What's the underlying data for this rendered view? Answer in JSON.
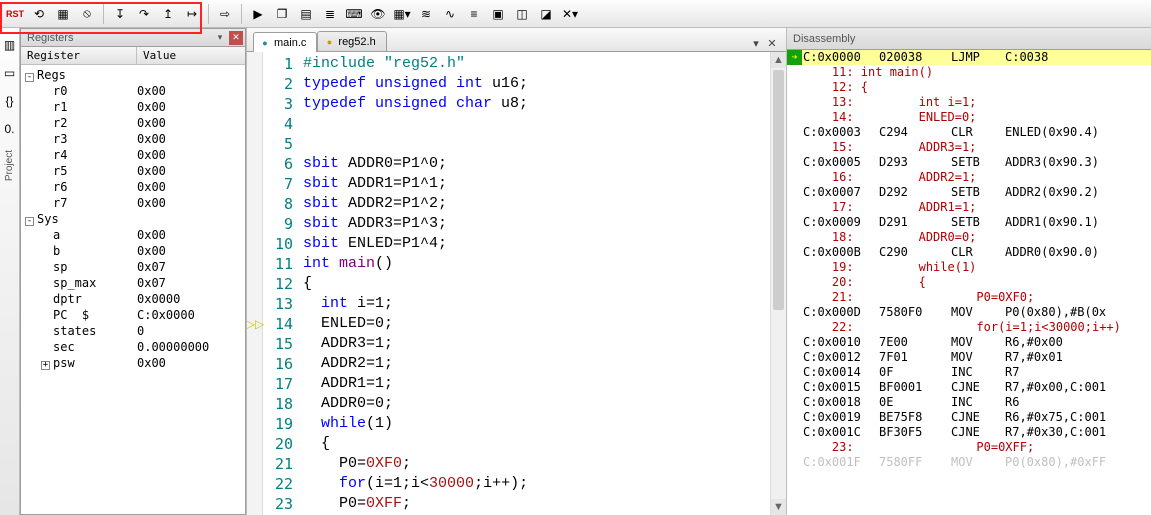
{
  "toolbar": {
    "groups": [
      [
        "reset-icon",
        "step-icon",
        "stop-icon"
      ],
      [
        "step-into-icon",
        "step-over-icon",
        "step-out-icon",
        "run-to-icon"
      ],
      [
        "arrow-right-icon"
      ],
      [
        "run-icon",
        "window-icon",
        "memory-icon",
        "list-icon",
        "output-icon",
        "watch-icon",
        "table-dd-icon",
        "serial-icon",
        "analyzer-icon",
        "trace-icon",
        "coverage-icon",
        "perf-icon",
        "perf2-icon",
        "tools-dd-icon"
      ]
    ],
    "glyphs": {
      "reset-icon": "⟲",
      "step-icon": "▦",
      "stop-icon": "⦸",
      "step-into-icon": "↧",
      "step-over-icon": "↷",
      "step-out-icon": "↥",
      "run-to-icon": "↦",
      "arrow-right-icon": "⇨",
      "run-icon": "▶",
      "window-icon": "❐",
      "memory-icon": "▤",
      "list-icon": "≣",
      "output-icon": "⌨",
      "watch-icon": "👁",
      "table-dd-icon": "▦▾",
      "serial-icon": "≋",
      "analyzer-icon": "∿",
      "trace-icon": "≡",
      "coverage-icon": "▣",
      "perf-icon": "◫",
      "perf2-icon": "◪",
      "tools-dd-icon": "✕▾"
    },
    "rst_label": "RST"
  },
  "sidebar": {
    "label": "Project"
  },
  "registers": {
    "title": "Registers",
    "columns": [
      "Register",
      "Value"
    ],
    "groups": [
      {
        "name": "Regs",
        "expanded": true,
        "items": [
          {
            "k": "r0",
            "v": "0x00"
          },
          {
            "k": "r1",
            "v": "0x00"
          },
          {
            "k": "r2",
            "v": "0x00"
          },
          {
            "k": "r3",
            "v": "0x00"
          },
          {
            "k": "r4",
            "v": "0x00"
          },
          {
            "k": "r5",
            "v": "0x00"
          },
          {
            "k": "r6",
            "v": "0x00"
          },
          {
            "k": "r7",
            "v": "0x00"
          }
        ]
      },
      {
        "name": "Sys",
        "expanded": true,
        "items": [
          {
            "k": "a",
            "v": "0x00"
          },
          {
            "k": "b",
            "v": "0x00"
          },
          {
            "k": "sp",
            "v": "0x07"
          },
          {
            "k": "sp_max",
            "v": "0x07"
          },
          {
            "k": "dptr",
            "v": "0x0000"
          },
          {
            "k": "PC  $",
            "v": "C:0x0000"
          },
          {
            "k": "states",
            "v": "0"
          },
          {
            "k": "sec",
            "v": "0.00000000"
          },
          {
            "k": "psw",
            "v": "0x00",
            "expandable": true
          }
        ]
      }
    ]
  },
  "tabs": {
    "items": [
      {
        "label": "main.c",
        "kind": "c",
        "active": true
      },
      {
        "label": "reg52.h",
        "kind": "h",
        "active": false
      }
    ]
  },
  "code": {
    "pc_line": 14,
    "lines": [
      {
        "n": 1,
        "seg": [
          {
            "t": "#include ",
            "c": "pp"
          },
          {
            "t": "\"reg52.h\"",
            "c": "str"
          }
        ]
      },
      {
        "n": 2,
        "seg": [
          {
            "t": "typedef unsigned int ",
            "c": "typ"
          },
          {
            "t": "u16;",
            "c": "ident"
          }
        ]
      },
      {
        "n": 3,
        "seg": [
          {
            "t": "typedef unsigned char ",
            "c": "typ"
          },
          {
            "t": "u8;",
            "c": "ident"
          }
        ]
      },
      {
        "n": 4,
        "seg": [
          {
            "t": "",
            "c": ""
          }
        ]
      },
      {
        "n": 5,
        "seg": [
          {
            "t": "",
            "c": ""
          }
        ]
      },
      {
        "n": 6,
        "seg": [
          {
            "t": "sbit ",
            "c": "kw"
          },
          {
            "t": "ADDR0=P1^0;",
            "c": "ident"
          }
        ]
      },
      {
        "n": 7,
        "seg": [
          {
            "t": "sbit ",
            "c": "kw"
          },
          {
            "t": "ADDR1=P1^1;",
            "c": "ident"
          }
        ]
      },
      {
        "n": 8,
        "seg": [
          {
            "t": "sbit ",
            "c": "kw"
          },
          {
            "t": "ADDR2=P1^2;",
            "c": "ident"
          }
        ]
      },
      {
        "n": 9,
        "seg": [
          {
            "t": "sbit ",
            "c": "kw"
          },
          {
            "t": "ADDR3=P1^3;",
            "c": "ident"
          }
        ]
      },
      {
        "n": 10,
        "seg": [
          {
            "t": "sbit ",
            "c": "kw"
          },
          {
            "t": "ENLED=P1^4;",
            "c": "ident"
          }
        ]
      },
      {
        "n": 11,
        "seg": [
          {
            "t": "int ",
            "c": "typ"
          },
          {
            "t": "main",
            "c": "func"
          },
          {
            "t": "()",
            "c": "ident"
          }
        ]
      },
      {
        "n": 12,
        "seg": [
          {
            "t": "{",
            "c": "ident"
          }
        ]
      },
      {
        "n": 13,
        "seg": [
          {
            "t": "  ",
            "c": ""
          },
          {
            "t": "int ",
            "c": "typ"
          },
          {
            "t": "i=1;",
            "c": "ident"
          }
        ]
      },
      {
        "n": 14,
        "seg": [
          {
            "t": "  ENLED=0;",
            "c": "ident"
          }
        ]
      },
      {
        "n": 15,
        "seg": [
          {
            "t": "  ADDR3=1;",
            "c": "ident"
          }
        ]
      },
      {
        "n": 16,
        "seg": [
          {
            "t": "  ADDR2=1;",
            "c": "ident"
          }
        ]
      },
      {
        "n": 17,
        "seg": [
          {
            "t": "  ADDR1=1;",
            "c": "ident"
          }
        ]
      },
      {
        "n": 18,
        "seg": [
          {
            "t": "  ADDR0=0;",
            "c": "ident"
          }
        ]
      },
      {
        "n": 19,
        "seg": [
          {
            "t": "  ",
            "c": ""
          },
          {
            "t": "while",
            "c": "kw"
          },
          {
            "t": "(1)",
            "c": "ident"
          }
        ]
      },
      {
        "n": 20,
        "seg": [
          {
            "t": "  {",
            "c": "ident"
          }
        ]
      },
      {
        "n": 21,
        "seg": [
          {
            "t": "    P0=",
            "c": "ident"
          },
          {
            "t": "0XF0",
            "c": "num"
          },
          {
            "t": ";",
            "c": "ident"
          }
        ]
      },
      {
        "n": 22,
        "seg": [
          {
            "t": "    ",
            "c": ""
          },
          {
            "t": "for",
            "c": "kw"
          },
          {
            "t": "(i=1;i<",
            "c": "ident"
          },
          {
            "t": "30000",
            "c": "num"
          },
          {
            "t": ";i++);",
            "c": "ident"
          }
        ]
      },
      {
        "n": 23,
        "seg": [
          {
            "t": "    P0=",
            "c": "ident"
          },
          {
            "t": "0XFF",
            "c": "num"
          },
          {
            "t": ";",
            "c": "ident"
          }
        ]
      }
    ]
  },
  "disassembly": {
    "title": "Disassembly",
    "lines": [
      {
        "type": "asm",
        "cur": true,
        "c1": "C:0x0000",
        "c2": "020038",
        "c3": "LJMP",
        "c4": "C:0038"
      },
      {
        "type": "src",
        "text": "    11: int main()"
      },
      {
        "type": "src",
        "text": "    12: {"
      },
      {
        "type": "src",
        "text": "    13:         int i=1;"
      },
      {
        "type": "src",
        "text": "    14:         ENLED=0;"
      },
      {
        "type": "asm",
        "c1": "C:0x0003",
        "c2": "C294",
        "c3": "CLR",
        "c4": "ENLED(0x90.4)"
      },
      {
        "type": "src",
        "text": "    15:         ADDR3=1;"
      },
      {
        "type": "asm",
        "c1": "C:0x0005",
        "c2": "D293",
        "c3": "SETB",
        "c4": "ADDR3(0x90.3)"
      },
      {
        "type": "src",
        "text": "    16:         ADDR2=1;"
      },
      {
        "type": "asm",
        "c1": "C:0x0007",
        "c2": "D292",
        "c3": "SETB",
        "c4": "ADDR2(0x90.2)"
      },
      {
        "type": "src",
        "text": "    17:         ADDR1=1;"
      },
      {
        "type": "asm",
        "c1": "C:0x0009",
        "c2": "D291",
        "c3": "SETB",
        "c4": "ADDR1(0x90.1)"
      },
      {
        "type": "src",
        "text": "    18:         ADDR0=0;"
      },
      {
        "type": "asm",
        "c1": "C:0x000B",
        "c2": "C290",
        "c3": "CLR",
        "c4": "ADDR0(0x90.0)"
      },
      {
        "type": "src",
        "text": "    19:         while(1)"
      },
      {
        "type": "src",
        "text": "    20:         {"
      },
      {
        "type": "src",
        "text": "    21:                 P0=0XF0;"
      },
      {
        "type": "asm",
        "c1": "C:0x000D",
        "c2": "7580F0",
        "c3": "MOV",
        "c4": "P0(0x80),#B(0x"
      },
      {
        "type": "src",
        "text": "    22:                 for(i=1;i<30000;i++)"
      },
      {
        "type": "asm",
        "c1": "C:0x0010",
        "c2": "7E00",
        "c3": "MOV",
        "c4": "R6,#0x00"
      },
      {
        "type": "asm",
        "c1": "C:0x0012",
        "c2": "7F01",
        "c3": "MOV",
        "c4": "R7,#0x01"
      },
      {
        "type": "asm",
        "c1": "C:0x0014",
        "c2": "0F",
        "c3": "INC",
        "c4": "R7"
      },
      {
        "type": "asm",
        "c1": "C:0x0015",
        "c2": "BF0001",
        "c3": "CJNE",
        "c4": "R7,#0x00,C:001"
      },
      {
        "type": "asm",
        "c1": "C:0x0018",
        "c2": "0E",
        "c3": "INC",
        "c4": "R6"
      },
      {
        "type": "asm",
        "c1": "C:0x0019",
        "c2": "BE75F8",
        "c3": "CJNE",
        "c4": "R6,#0x75,C:001"
      },
      {
        "type": "asm",
        "c1": "C:0x001C",
        "c2": "BF30F5",
        "c3": "CJNE",
        "c4": "R7,#0x30,C:001"
      },
      {
        "type": "src",
        "text": "    23:                 P0=0XFF;"
      },
      {
        "type": "asm",
        "wm": true,
        "c1": "C:0x001F",
        "c2": "7580FF",
        "c3": "MOV",
        "c4": "P0(0x80),#0xFF"
      }
    ]
  }
}
